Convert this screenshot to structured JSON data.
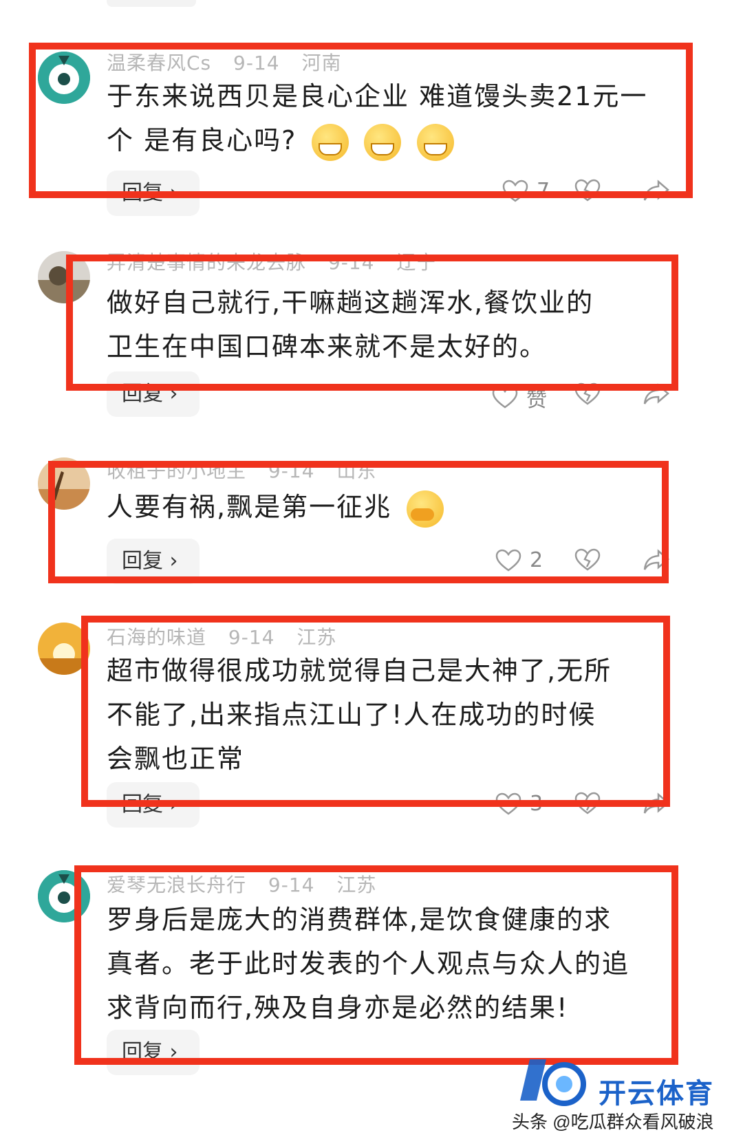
{
  "reply_label": "回复 ›",
  "comments": [
    {
      "username": "温柔春风Cs",
      "date": "9-14",
      "location": "河南",
      "text_lines": [
        "于东来说西贝是良心企业 难道馒头卖21元一",
        "个 是有良心吗?"
      ],
      "like_count": "7",
      "avatar": "teal-cartoon"
    },
    {
      "username": "弄清楚事情的来龙去脉",
      "date": "9-14",
      "location": "辽宁",
      "text_lines": [
        "做好自己就行,干嘛趟这趟浑水,餐饮业的",
        "卫生在中国口碑本来就不是太好的。"
      ],
      "like_count": "赞",
      "avatar": "landscape"
    },
    {
      "username": "收租子的小地主",
      "date": "9-14",
      "location": "山东",
      "text_lines": [
        "人要有祸,飘是第一征兆"
      ],
      "like_count": "2",
      "avatar": "desert"
    },
    {
      "username": "石海的味道",
      "date": "9-14",
      "location": "江苏",
      "text_lines": [
        "超市做得很成功就觉得自己是大神了,无所",
        "不能了,出来指点江山了!人在成功的时候",
        "会飘也正常"
      ],
      "like_count": "3",
      "avatar": "sunrise"
    },
    {
      "username": "爱琴无浪长舟行",
      "date": "9-14",
      "location": "江苏",
      "text_lines": [
        "罗身后是庞大的消费群体,是饮食健康的求",
        "真者。老于此时发表的个人观点与众人的追",
        "求背向而行,殃及自身亦是必然的结果!"
      ],
      "like_count": "",
      "avatar": "teal-cartoon"
    }
  ],
  "watermark": {
    "brand": "开云体育",
    "source": "头条 @吃瓜群众看风破浪"
  },
  "colors": {
    "highlight_box": "#f0321c",
    "meta_text": "#b6b6b6",
    "avatar_teal": "#2fa79a",
    "brand_blue": "#1b62c9"
  }
}
